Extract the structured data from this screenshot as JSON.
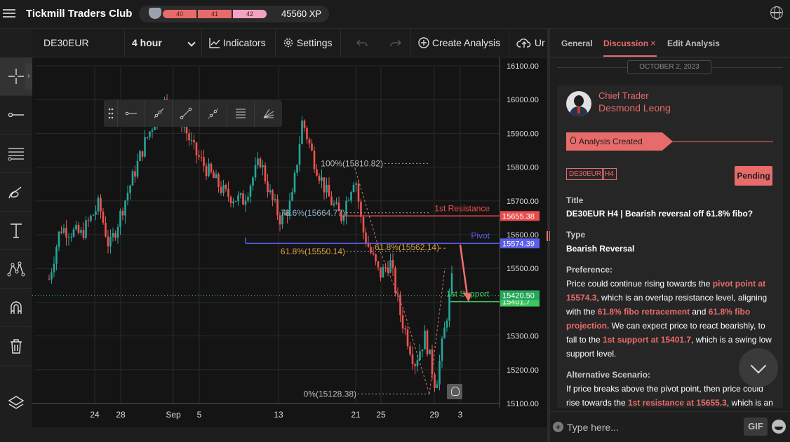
{
  "app": {
    "title": "Tickmill Traders Club",
    "xp_levels": [
      "40",
      "41",
      "42"
    ],
    "xp": "45560 XP"
  },
  "toolbar": {
    "symbol": "DE30EUR",
    "timeframe": "4 hour",
    "indicators": "Indicators",
    "settings": "Settings",
    "create_analysis": "Create Analysis",
    "upload": "Ur"
  },
  "chart_data": {
    "type": "candlestick",
    "symbol": "DE30EUR",
    "ylim": [
      15100,
      16100
    ],
    "y_ticks": [
      "16100.00",
      "16000.00",
      "15900.00",
      "15800.00",
      "15700.00",
      "15600.00",
      "15500.00",
      "15400.00",
      "15300.00",
      "15200.00",
      "15100.00"
    ],
    "x_ticks": [
      "24",
      "28",
      "Sep",
      "5",
      "13",
      "21",
      "25",
      "29",
      "3"
    ],
    "levels": [
      {
        "name": "1st Resistance",
        "value": 15655.38,
        "label": "15655.38",
        "color": "#e84c4c"
      },
      {
        "name": "Pivot",
        "value": 15574.39,
        "label": "15574.39",
        "color": "#5a5ee8"
      },
      {
        "name": "1st Support",
        "value": 15401.7,
        "label": "15401.7",
        "color": "#3cc65e"
      }
    ],
    "current_price": "15420.50",
    "fib_retracement": [
      {
        "label": "100%(15810.82)",
        "value": 15810.82
      },
      {
        "label": "78.6%(15664.77)",
        "value": 15664.77
      },
      {
        "label": "61.8%(15550.14)",
        "value": 15550.14
      },
      {
        "label": "0%(15128.38)",
        "value": 15128.38
      }
    ],
    "fib_projection": [
      {
        "label": "61.8%(15562.14)",
        "value": 15562.14
      }
    ],
    "colors": {
      "up": "#26a69a",
      "down": "#ef5350"
    }
  },
  "panel": {
    "tabs": [
      "General",
      "Discussion",
      "Edit Analysis"
    ],
    "date": "OCTOBER 2, 2023",
    "author_role": "Chief Trader",
    "author_name": "Desmond Leong",
    "badge": "Analysis Created",
    "tags": [
      "DE30EUR",
      "H4"
    ],
    "status": "Pending",
    "title_label": "Title",
    "title": "DE30EUR H4 | Bearish reversal off 61.8% fibo?",
    "type_label": "Type",
    "type": "Bearish Reversal",
    "pref_label": "Preference:",
    "pref_parts": [
      "Price could continue rising towards the ",
      "pivot point at 15574.3",
      ", which is an overlap resistance level, aligning with the ",
      "61.8% fibo retracement",
      " and ",
      "61.8% fibo projection.",
      " We can expect price to react bearishly, to fall to the ",
      "1st support at 15401.7",
      ", which is a swing low support level."
    ],
    "alt_label": "Alternative Scenario:",
    "alt_parts": [
      "If price breaks above the pivot point, then price could rise towards the ",
      "1st resistance at 15655.3",
      ", which is an"
    ],
    "input_placeholder": "Type here...",
    "gif": "GIF"
  }
}
